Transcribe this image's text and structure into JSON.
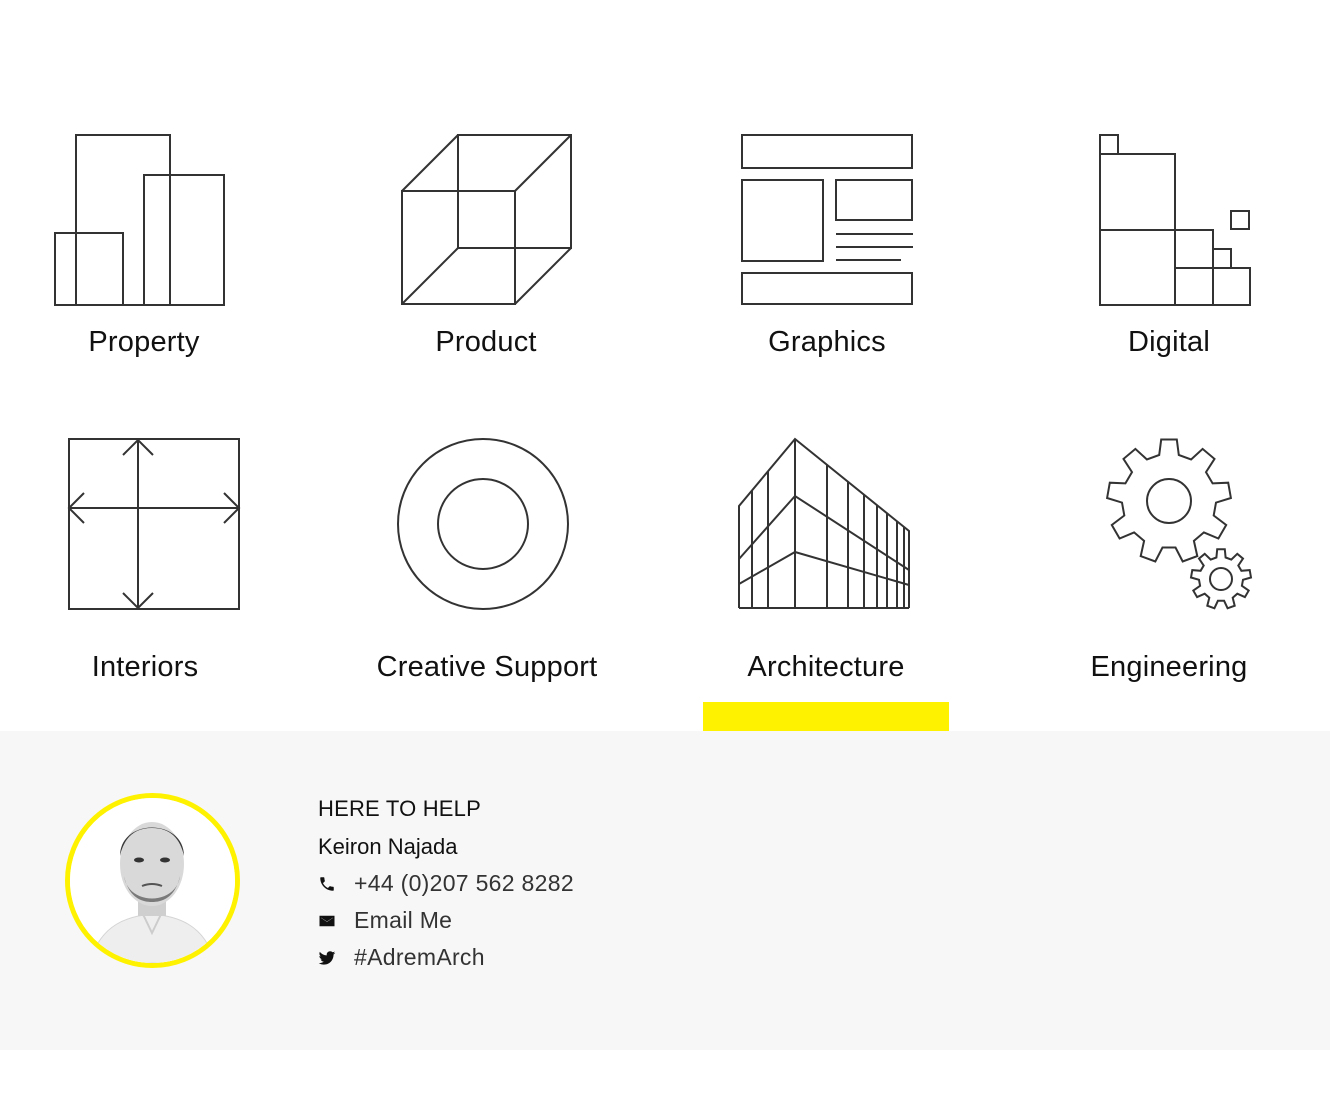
{
  "services": [
    {
      "label": "Property",
      "icon": "property-buildings-icon"
    },
    {
      "label": "Product",
      "icon": "cube-icon"
    },
    {
      "label": "Graphics",
      "icon": "layout-icon"
    },
    {
      "label": "Digital",
      "icon": "pixel-blocks-icon"
    },
    {
      "label": "Interiors",
      "icon": "expand-arrows-icon"
    },
    {
      "label": "Creative Support",
      "icon": "ring-icon"
    },
    {
      "label": "Architecture",
      "icon": "building-facade-icon",
      "active": true
    },
    {
      "label": "Engineering",
      "icon": "gears-icon"
    }
  ],
  "active_service": "Architecture",
  "colors": {
    "accent": "#fff200",
    "panel_bg": "#f7f7f7",
    "icon_stroke": "#333333",
    "text": "#111111"
  },
  "contact": {
    "heading": "HERE TO HELP",
    "name": "Keiron Najada",
    "phone": "+44 (0)207 562 8282",
    "email_label": "Email Me",
    "twitter": "#AdremArch",
    "icons": [
      "phone-icon",
      "envelope-icon",
      "twitter-icon"
    ]
  }
}
